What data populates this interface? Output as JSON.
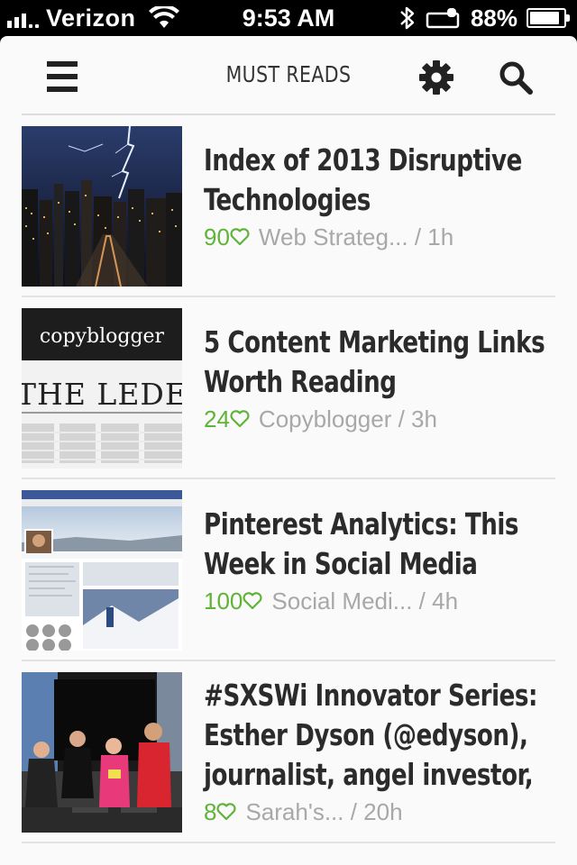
{
  "status_bar": {
    "carrier": "Verizon",
    "time": "9:53 AM",
    "battery_percent": "88%",
    "battery_level": 0.88
  },
  "nav": {
    "title": "MUST READS",
    "icons": [
      "menu-icon",
      "gear-icon",
      "search-icon"
    ]
  },
  "articles": [
    {
      "title": "Index of 2013 Disruptive Technologies",
      "likes": "90",
      "source": "Web Strateg... / 1h",
      "thumb": "city-lightning"
    },
    {
      "title": "5 Content Marketing Links Worth Reading",
      "likes": "24",
      "source": "Copyblogger / 3h",
      "thumb": "copyblogger-the-lede",
      "thumb_text": {
        "brand": "copyblogger",
        "masthead": "THE LEDE"
      }
    },
    {
      "title": "Pinterest Analytics: This Week in Social Media",
      "likes": "100",
      "source": "Social Medi... / 4h",
      "thumb": "facebook-profile-screenshot"
    },
    {
      "title": "#SXSWi Innovator Series: Esther Dyson (@edyson), journalist, angel investor,",
      "likes": "8",
      "source": "Sarah's... / 20h",
      "thumb": "people-at-samsung-lounge"
    }
  ],
  "colors": {
    "accent_green": "#5fb336",
    "meta_gray": "#a8a8a8",
    "title_text": "#2b2b2b",
    "background": "#fafafa"
  }
}
